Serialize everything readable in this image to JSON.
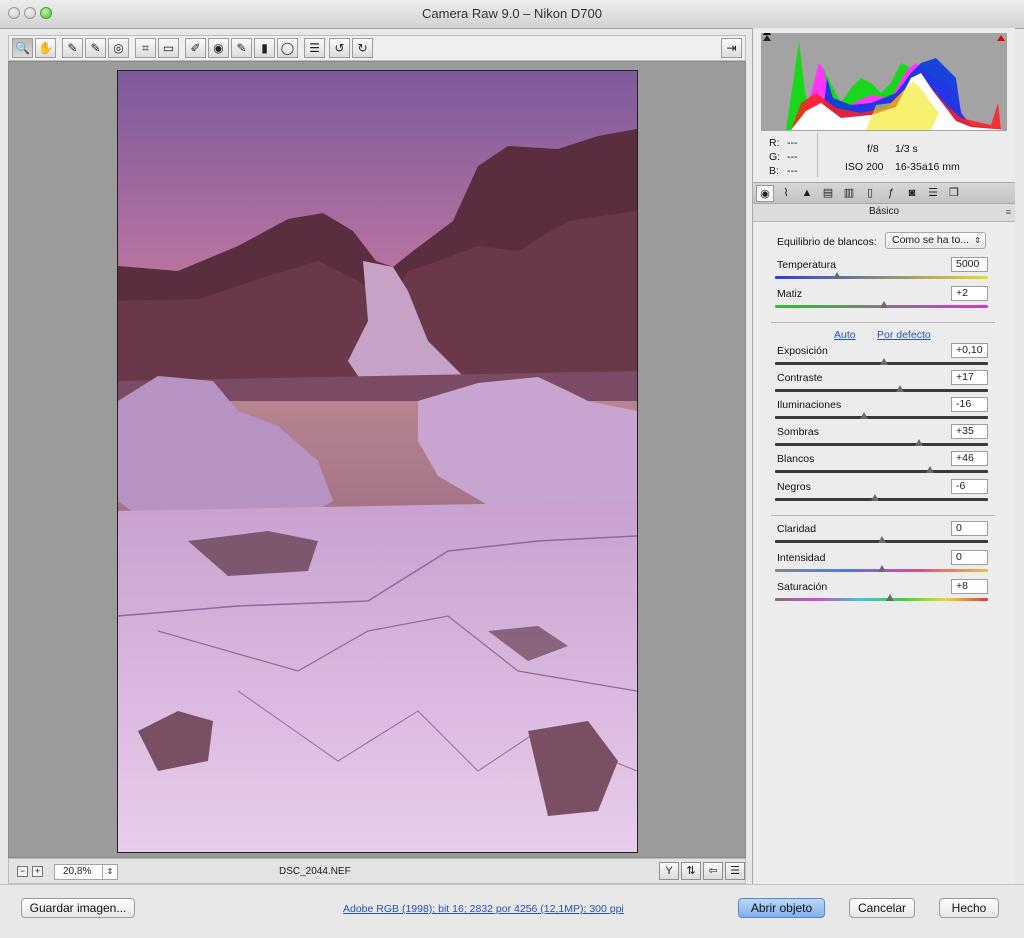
{
  "window": {
    "title": "Camera Raw 9.0 –  Nikon D700"
  },
  "toolbar": {
    "tools": [
      {
        "name": "zoom-tool",
        "glyph": "🔍"
      },
      {
        "name": "hand-tool",
        "glyph": "✋"
      },
      {
        "name": "white-balance-tool",
        "glyph": "✎"
      },
      {
        "name": "color-sampler-tool",
        "glyph": "✎"
      },
      {
        "name": "targeted-adjustment-tool",
        "glyph": "◎"
      },
      {
        "name": "crop-tool",
        "glyph": "⌗"
      },
      {
        "name": "straighten-tool",
        "glyph": "▭"
      },
      {
        "name": "spot-removal-tool",
        "glyph": "✐"
      },
      {
        "name": "red-eye-tool",
        "glyph": "◉"
      },
      {
        "name": "adjustment-brush-tool",
        "glyph": "✎"
      },
      {
        "name": "graduated-filter-tool",
        "glyph": "▮"
      },
      {
        "name": "radial-filter-tool",
        "glyph": "◯"
      },
      {
        "name": "preferences-tool",
        "glyph": "☰"
      },
      {
        "name": "rotate-left-tool",
        "glyph": "↺"
      },
      {
        "name": "rotate-right-tool",
        "glyph": "↻"
      }
    ],
    "fullscreen_glyph": "⇥"
  },
  "preview": {
    "zoom_value": "20,8%",
    "zoom_minus": "−",
    "zoom_plus": "+",
    "filename": "DSC_2044.NEF"
  },
  "readout": {
    "r_label": "R:",
    "r_value": "---",
    "g_label": "G:",
    "g_value": "---",
    "b_label": "B:",
    "b_value": "---",
    "aperture": "f/8",
    "shutter": "1/3 s",
    "iso": "ISO 200",
    "lens": "16-35a16 mm"
  },
  "panel": {
    "section_title": "Básico",
    "wb_label": "Equilibrio de blancos:",
    "wb_value": "Como se ha to...",
    "auto_link": "Auto",
    "default_link": "Por defecto",
    "sliders": {
      "temperatura": {
        "label": "Temperatura",
        "value": "5000",
        "position": 0.29
      },
      "matiz": {
        "label": "Matiz",
        "value": "+2",
        "position": 0.51
      },
      "exposicion": {
        "label": "Exposición",
        "value": "+0,10",
        "position": 0.51
      },
      "contraste": {
        "label": "Contraste",
        "value": "+17",
        "position": 0.585
      },
      "iluminaciones": {
        "label": "Iluminaciones",
        "value": "-16",
        "position": 0.42
      },
      "sombras": {
        "label": "Sombras",
        "value": "+35",
        "position": 0.675
      },
      "blancos": {
        "label": "Blancos",
        "value": "+46",
        "position": 0.73
      },
      "negros": {
        "label": "Negros",
        "value": "-6",
        "position": 0.47
      },
      "claridad": {
        "label": "Claridad",
        "value": "0",
        "position": 0.5
      },
      "intensidad": {
        "label": "Intensidad",
        "value": "0",
        "position": 0.5
      },
      "saturacion": {
        "label": "Saturación",
        "value": "+8",
        "position": 0.54
      }
    }
  },
  "footer": {
    "save_label": "Guardar imagen...",
    "workflow_link": "Adobe RGB (1998); bit 16; 2832 por 4256 (12,1MP); 300 ppi",
    "open_label": "Abrir objeto",
    "cancel_label": "Cancelar",
    "done_label": "Hecho"
  }
}
